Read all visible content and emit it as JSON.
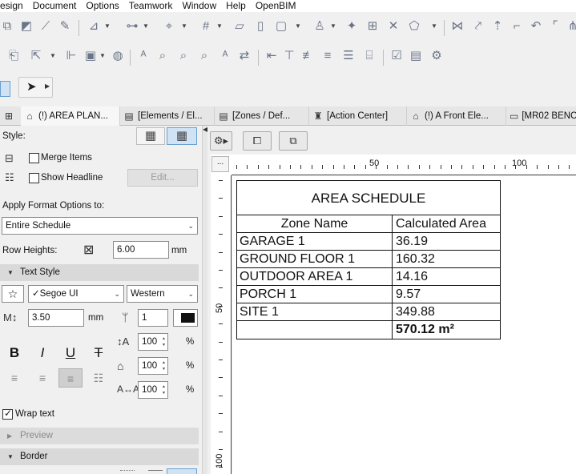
{
  "menu": [
    "esign",
    "Document",
    "Options",
    "Teamwork",
    "Window",
    "Help",
    "OpenBIM"
  ],
  "tabs": [
    {
      "label": "(!) AREA PLAN...",
      "icon": "floor-plan-icon"
    },
    {
      "label": "[Elements / El...",
      "icon": "schedule-icon"
    },
    {
      "label": "[Zones /  Def...",
      "icon": "schedule-icon"
    },
    {
      "label": "[Action Center]",
      "icon": "action-center-icon"
    },
    {
      "label": "(!) A Front Ele...",
      "icon": "elevation-icon"
    },
    {
      "label": "[MR02 BENCH",
      "icon": "layout-icon"
    }
  ],
  "panel": {
    "style_label": "Style:",
    "merge_items": "Merge Items",
    "show_headline": "Show Headline",
    "edit_button": "Edit...",
    "apply_format_label": "Apply Format Options to:",
    "apply_format_value": "Entire Schedule",
    "row_heights_label": "Row Heights:",
    "row_heights_value": "6.00",
    "row_heights_unit": "mm",
    "text_style_section": "Text Style",
    "font_value": "✓Segoe UI",
    "script_value": "Western",
    "font_size_value": "3.50",
    "font_size_unit": "mm",
    "pen_value": "1",
    "line_spacing_value": "100",
    "char_width_value": "100",
    "char_spacing_value": "100",
    "percent": "%",
    "wrap_text": "Wrap text",
    "preview_section": "Preview",
    "border_section": "Border"
  },
  "ruler": {
    "h_labels": [
      "50",
      "100"
    ],
    "v_labels": [
      "50",
      "100"
    ]
  },
  "schedule": {
    "title": "AREA SCHEDULE",
    "headers": [
      "Zone Name",
      "Calculated Area"
    ],
    "rows": [
      [
        "GARAGE 1",
        "36.19"
      ],
      [
        "GROUND FLOOR 1",
        "160.32"
      ],
      [
        "OUTDOOR AREA 1",
        "14.16"
      ],
      [
        "PORCH 1",
        "9.57"
      ],
      [
        "SITE 1",
        "349.88"
      ]
    ],
    "total": "570.12 m²"
  },
  "colors": {
    "selected_blue": "#cfe3f5",
    "panel_bg": "#f0f0f0",
    "section_bg": "#d9d9d9"
  }
}
